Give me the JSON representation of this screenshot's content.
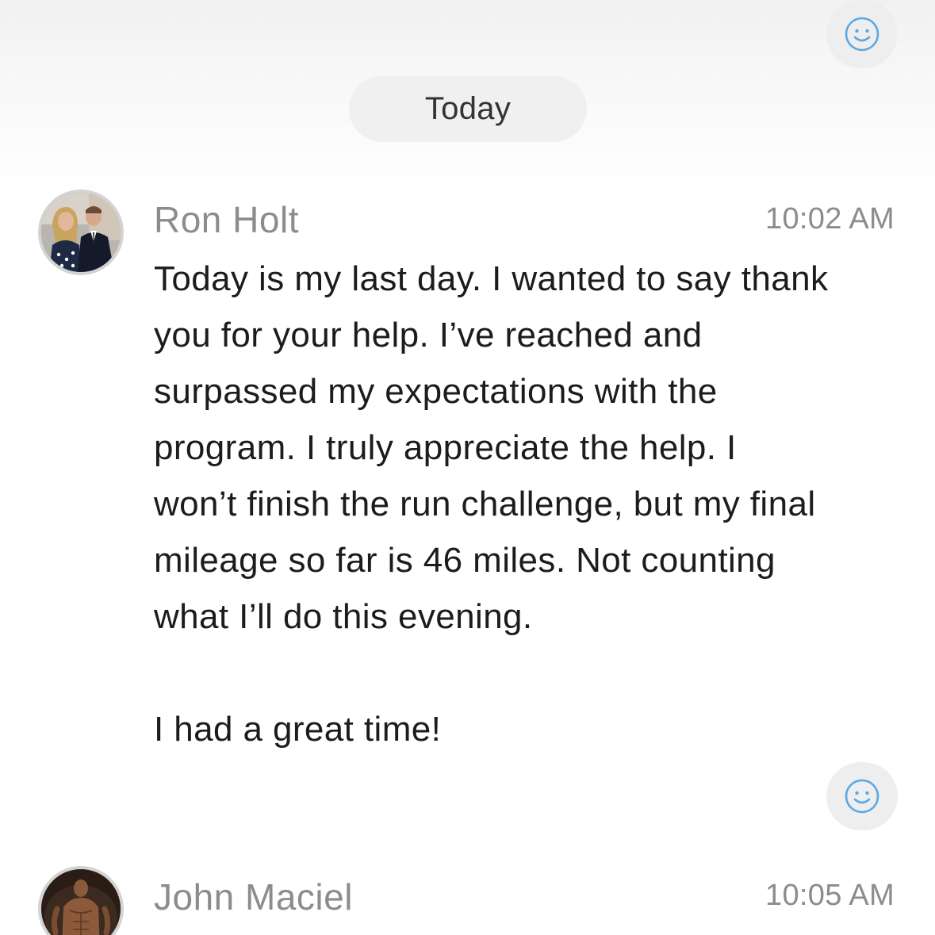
{
  "date_separator": "Today",
  "reaction_icon": "smiley-icon",
  "accent_color": "#5aa8e6",
  "messages": [
    {
      "sender": "Ron Holt",
      "time": "10:02 AM",
      "avatar": "profile photo",
      "body_lines": [
        "Today is my last day. I wanted to say thank",
        "you for your help. I’ve reached and",
        "surpassed my expectations with the",
        "program. I truly appreciate the help. I",
        "won’t finish the run challenge, but my final",
        "mileage so far is 46 miles. Not counting",
        "what I’ll do this evening."
      ],
      "closing_line": "I had a great time!"
    },
    {
      "sender": "John Maciel",
      "time": "10:05 AM",
      "avatar": "profile photo"
    }
  ]
}
